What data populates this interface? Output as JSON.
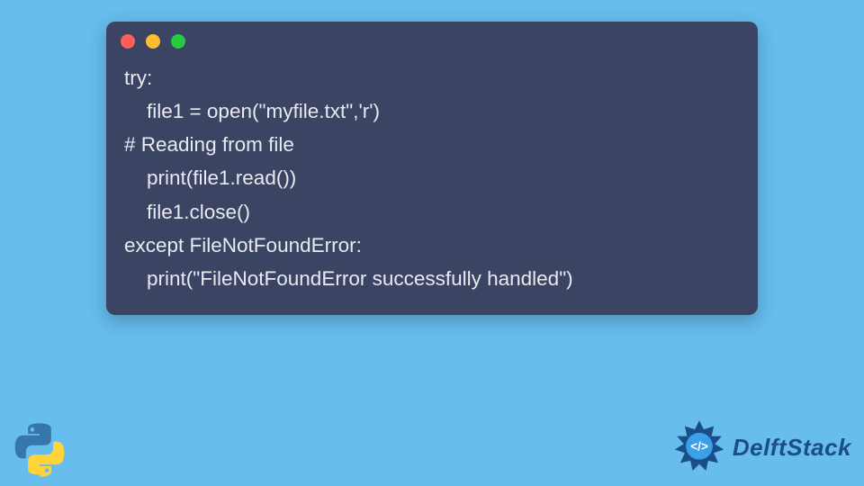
{
  "window": {
    "traffic_lights": {
      "red": "#ff5f56",
      "yellow": "#ffbd2e",
      "green": "#27c93f"
    }
  },
  "code": {
    "line1": "try:",
    "line2": "    file1 = open(\"myfile.txt\",'r')",
    "line3": "# Reading from file",
    "line4": "    print(file1.read())",
    "line5": "    file1.close()",
    "line6": "except FileNotFoundError:",
    "line7": "    print(\"FileNotFoundError successfully handled\")"
  },
  "branding": {
    "delftstack": "DelftStack"
  },
  "colors": {
    "page_bg": "#66bdee",
    "window_bg": "#3b4463",
    "code_text": "#e8eaf0",
    "brand_text": "#1b4d8a"
  }
}
